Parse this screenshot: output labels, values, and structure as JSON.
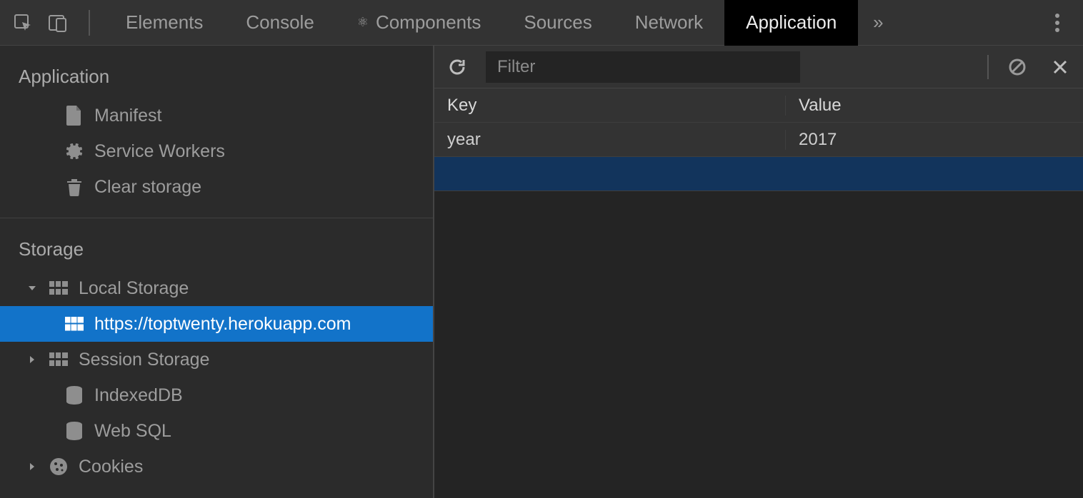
{
  "tabs": {
    "elements": "Elements",
    "console": "Console",
    "components": "Components",
    "sources": "Sources",
    "network": "Network",
    "application": "Application",
    "overflow": "»"
  },
  "sidebar": {
    "sections": {
      "application": "Application",
      "storage": "Storage"
    },
    "app_items": {
      "manifest": "Manifest",
      "service_workers": "Service Workers",
      "clear_storage": "Clear storage"
    },
    "storage_items": {
      "local_storage": "Local Storage",
      "local_storage_origin": "https://toptwenty.herokuapp.com",
      "session_storage": "Session Storage",
      "indexeddb": "IndexedDB",
      "websql": "Web SQL",
      "cookies": "Cookies"
    }
  },
  "toolbar": {
    "filter_placeholder": "Filter"
  },
  "table": {
    "headers": {
      "key": "Key",
      "value": "Value"
    },
    "rows": [
      {
        "key": "year",
        "value": "2017"
      }
    ]
  }
}
